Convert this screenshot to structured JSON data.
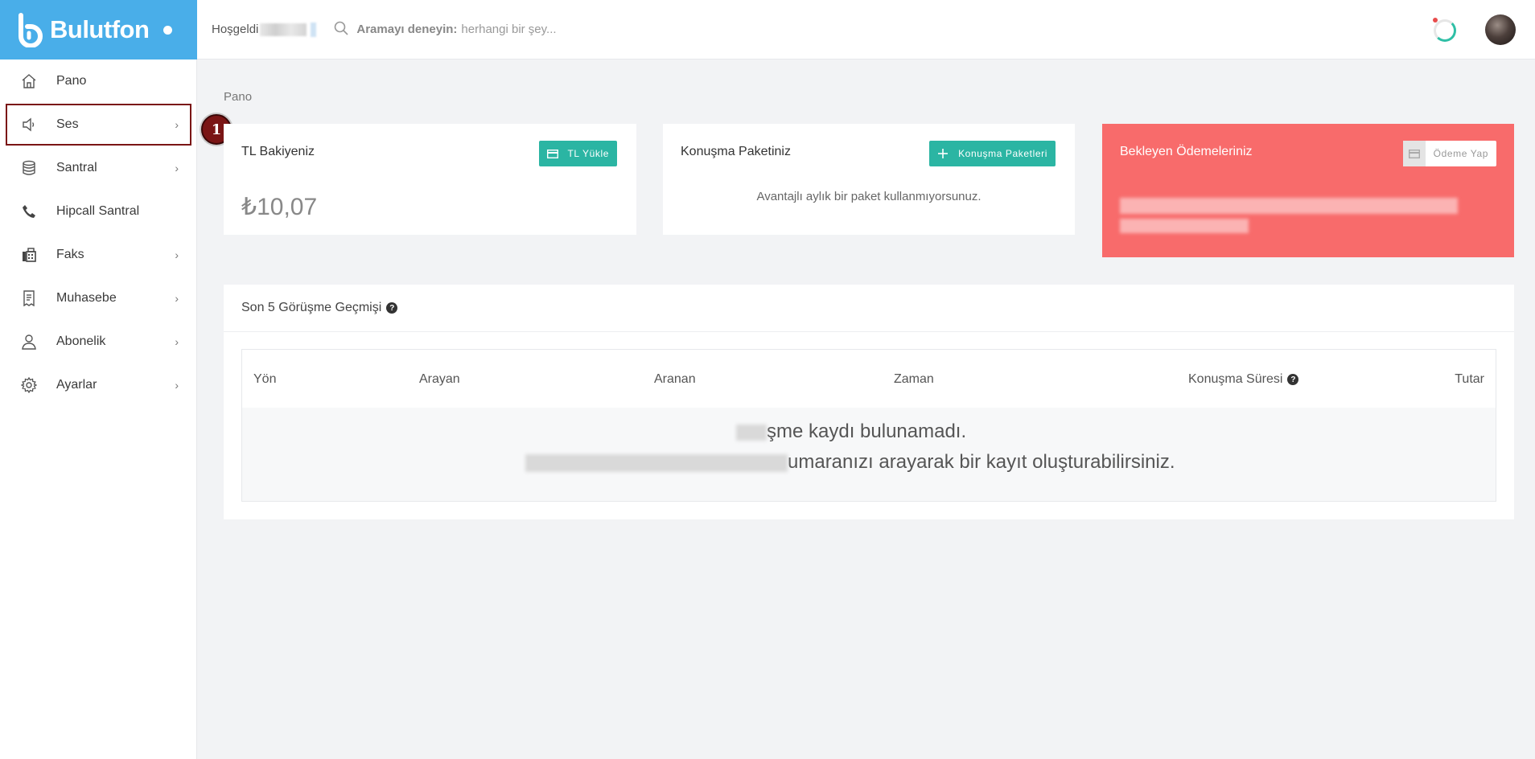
{
  "brand": {
    "name": "Bulutfon",
    "color": "#49aee9"
  },
  "topbar": {
    "welcome": "Hoşgeldi",
    "search_label": "Aramayı deneyin:",
    "search_placeholder": "herhangi bir şey..."
  },
  "sidebar": {
    "items": [
      {
        "label": "Pano",
        "icon": "home-icon",
        "has_chevron": false
      },
      {
        "label": "Ses",
        "icon": "speaker-icon",
        "has_chevron": true
      },
      {
        "label": "Santral",
        "icon": "database-icon",
        "has_chevron": true
      },
      {
        "label": "Hipcall Santral",
        "icon": "phone-icon",
        "has_chevron": false
      },
      {
        "label": "Faks",
        "icon": "fax-icon",
        "has_chevron": true
      },
      {
        "label": "Muhasebe",
        "icon": "receipt-icon",
        "has_chevron": true
      },
      {
        "label": "Abonelik",
        "icon": "user-icon",
        "has_chevron": true
      },
      {
        "label": "Ayarlar",
        "icon": "gear-icon",
        "has_chevron": true
      }
    ],
    "chevron": "›"
  },
  "annotation": {
    "marker": "1"
  },
  "main": {
    "breadcrumb": "Pano",
    "balance_card": {
      "title": "TL Bakiyeniz",
      "button": "TL Yükle",
      "amount": "₺10,07"
    },
    "package_card": {
      "title": "Konuşma Paketiniz",
      "button": "Konuşma Paketleri",
      "message": "Avantajlı aylık bir paket kullanmıyorsunuz."
    },
    "payments_card": {
      "title": "Bekleyen Ödemeleriniz",
      "button": "Ödeme Yap",
      "color": "#f86b6b"
    },
    "history": {
      "title": "Son 5 Görüşme Geçmişi",
      "columns": [
        "Yön",
        "Arayan",
        "Aranan",
        "Zaman",
        "Konuşma Süresi",
        "Tutar"
      ],
      "empty_line1": "şme kaydı bulunamadı.",
      "empty_line2": "umaranızı arayarak bir kayıt oluşturabilirsiniz."
    }
  },
  "colors": {
    "accent": "#2bb5a3",
    "marker": "#7a1515"
  }
}
